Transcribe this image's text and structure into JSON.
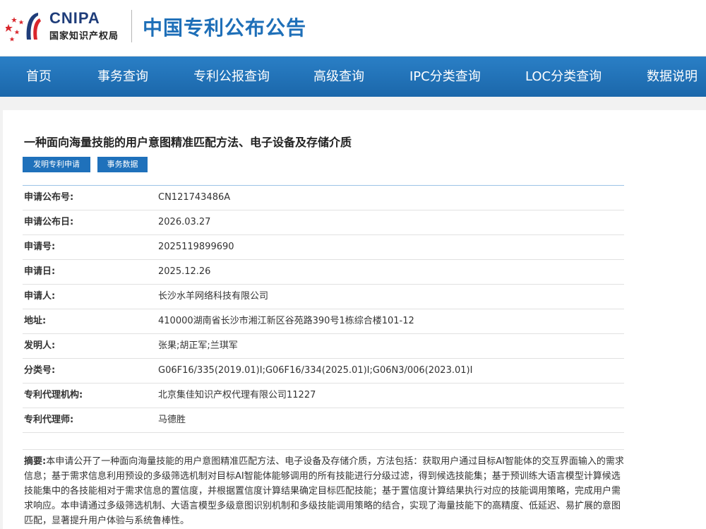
{
  "header": {
    "logo_text": "CNIPA",
    "logo_subtitle": "国家知识产权局",
    "site_title": "中国专利公布公告"
  },
  "nav": {
    "items": [
      {
        "label": "首页"
      },
      {
        "label": "事务查询"
      },
      {
        "label": "专利公报查询"
      },
      {
        "label": "高级查询"
      },
      {
        "label": "IPC分类查询"
      },
      {
        "label": "LOC分类查询"
      },
      {
        "label": "数据说明"
      }
    ]
  },
  "patent": {
    "title": "一种面向海量技能的用户意图精准匹配方法、电子设备及存储介质",
    "tags": [
      "发明专利申请",
      "事务数据"
    ],
    "fields": [
      {
        "label": "申请公布号:",
        "value": "CN121743486A"
      },
      {
        "label": "申请公布日:",
        "value": "2026.03.27"
      },
      {
        "label": "申请号:",
        "value": "2025119899690"
      },
      {
        "label": "申请日:",
        "value": "2025.12.26"
      },
      {
        "label": "申请人:",
        "value": "长沙水羊网络科技有限公司"
      },
      {
        "label": "地址:",
        "value": "410000湖南省长沙市湘江新区谷苑路390号1栋综合楼101-12"
      },
      {
        "label": "发明人:",
        "value": "张果;胡正军;兰琪军"
      },
      {
        "label": "分类号:",
        "value": "G06F16/335(2019.01)I;G06F16/334(2025.01)I;G06N3/006(2023.01)I"
      },
      {
        "label": "专利代理机构:",
        "value": "北京集佳知识产权代理有限公司11227"
      },
      {
        "label": "专利代理师:",
        "value": "马德胜"
      }
    ],
    "abstract_label": "摘要:",
    "abstract_text": "本申请公开了一种面向海量技能的用户意图精准匹配方法、电子设备及存储介质，方法包括：获取用户通过目标AI智能体的交互界面输入的需求信息；基于需求信息利用预设的多级筛选机制对目标AI智能体能够调用的所有技能进行分级过滤，得到候选技能集；基于预训练大语言模型计算候选技能集中的各技能相对于需求信息的置信度，并根据置信度计算结果确定目标匹配技能；基于置信度计算结果执行对应的技能调用策略，完成用户需求响应。本申请通过多级筛选机制、大语言模型多级意图识别机制和多级技能调用策略的结合，实现了海量技能下的高精度、低延迟、易扩展的意图匹配，显著提升用户体验与系统鲁棒性。"
  },
  "colors": {
    "brand_blue": "#1e6fb8",
    "nav_blue": "#2a7fc6",
    "button_blue": "#1f71bb",
    "logo_red": "#d9262c"
  }
}
